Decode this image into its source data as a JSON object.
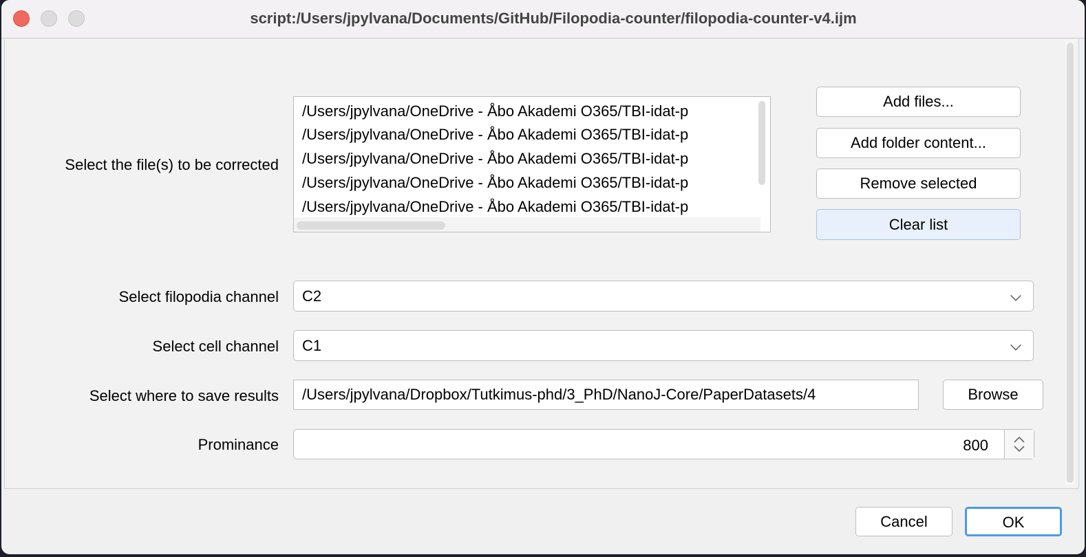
{
  "window": {
    "title": "script:/Users/jpylvana/Documents/GitHub/Filopodia-counter/filopodia-counter-v4.ijm",
    "controls": [
      "close-icon",
      "minimize-icon",
      "zoom-icon"
    ],
    "close_color": "#ee6a5e"
  },
  "files": {
    "label": "Select the file(s) to be corrected",
    "items": [
      "/Users/jpylvana/OneDrive - Åbo Akademi O365/TBI-idat-p",
      "/Users/jpylvana/OneDrive - Åbo Akademi O365/TBI-idat-p",
      "/Users/jpylvana/OneDrive - Åbo Akademi O365/TBI-idat-p",
      "/Users/jpylvana/OneDrive - Åbo Akademi O365/TBI-idat-p",
      "/Users/jpylvana/OneDrive - Åbo Akademi O365/TBI-idat-p"
    ],
    "buttons": {
      "add_files": "Add files...",
      "add_folder": "Add folder content...",
      "remove": "Remove selected",
      "clear": "Clear list"
    }
  },
  "filopodia_channel": {
    "label": "Select filopodia channel",
    "value": "C2"
  },
  "cell_channel": {
    "label": "Select cell channel",
    "value": "C1"
  },
  "save": {
    "label": "Select where to save results",
    "value": "/Users/jpylvana/Dropbox/Tutkimus-phd/3_PhD/NanoJ-Core/PaperDatasets/4",
    "browse": "Browse"
  },
  "prominance": {
    "label": "Prominance",
    "value": "800"
  },
  "footer": {
    "cancel": "Cancel",
    "ok": "OK"
  },
  "colors": {
    "accent": "#4a9ae8",
    "selected_button": "#e8f1fb"
  }
}
